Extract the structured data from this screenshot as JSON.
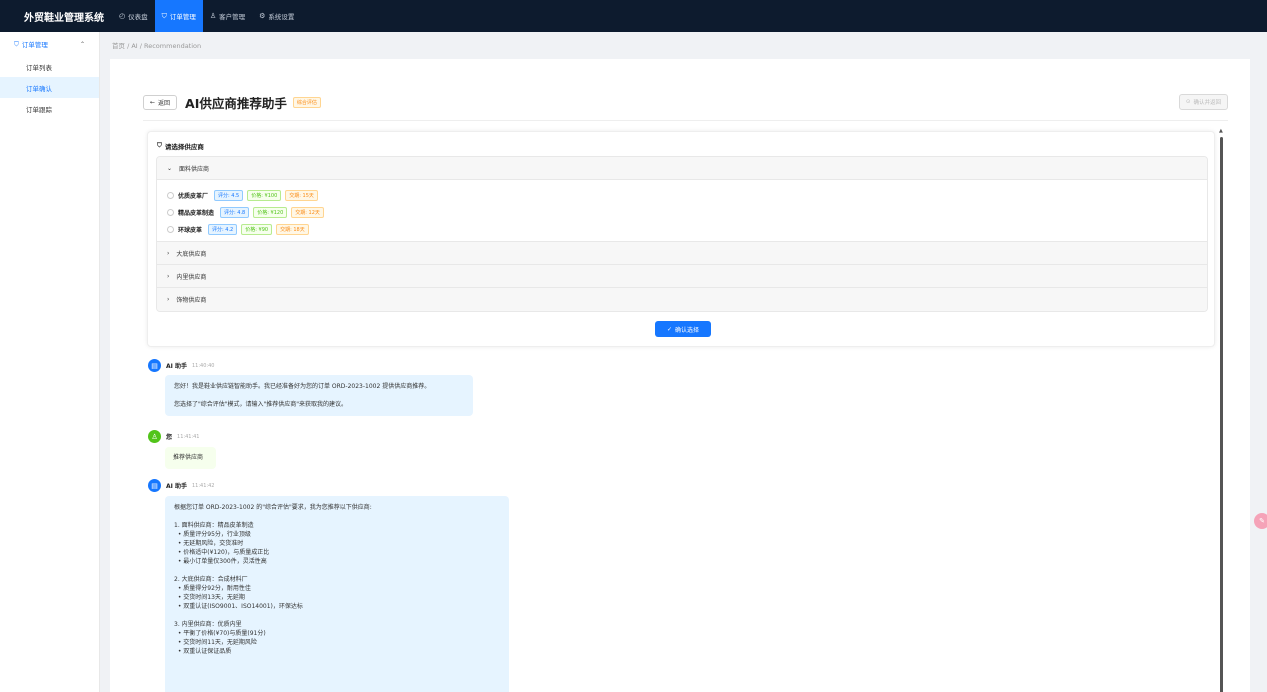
{
  "app": {
    "brand": "外贸鞋业管理系统"
  },
  "topnav": [
    {
      "icon": "dashboard-icon",
      "glyph": "◴",
      "label": "仪表盘",
      "active": false
    },
    {
      "icon": "cart-icon",
      "glyph": "⛉",
      "label": "订单管理",
      "active": true
    },
    {
      "icon": "user-icon",
      "glyph": "♙",
      "label": "客户管理",
      "active": false
    },
    {
      "icon": "gear-icon",
      "glyph": "⚙",
      "label": "系统设置",
      "active": false
    }
  ],
  "sidebar": {
    "group": "订单管理",
    "items": [
      {
        "label": "订单列表",
        "active": false
      },
      {
        "label": "订单确认",
        "active": true
      },
      {
        "label": "订单跟踪",
        "active": false
      }
    ]
  },
  "breadcrumb": "首页 / AI / Recommendation",
  "header": {
    "back_label": "返回",
    "title": "AI供应商推荐助手",
    "mode_tag": "综合评估",
    "confirm_back_label": "确认并返回"
  },
  "selector": {
    "title": "请选择供应商",
    "groups": [
      {
        "label": "面料供应商",
        "expanded": true
      },
      {
        "label": "大底供应商",
        "expanded": false
      },
      {
        "label": "内里供应商",
        "expanded": false
      },
      {
        "label": "饰物供应商",
        "expanded": false
      }
    ],
    "options": [
      {
        "name": "优质皮革厂",
        "score": "评分: 4.5",
        "price": "价格: ¥100",
        "lead": "交期: 15天"
      },
      {
        "name": "精品皮革制造",
        "score": "评分: 4.8",
        "price": "价格: ¥120",
        "lead": "交期: 12天"
      },
      {
        "name": "环球皮革",
        "score": "评分: 4.2",
        "price": "价格: ¥90",
        "lead": "交期: 18天"
      }
    ],
    "confirm_label": "确认选择"
  },
  "chat": [
    {
      "role": "ai",
      "sender": "AI 助手",
      "time": "11:40:40",
      "lines": [
        "您好！我是鞋业供应链智能助手。我已经准备好为您的订单 ORD-2023-1002 提供供应商推荐。",
        "",
        "您选择了\"综合评估\"模式，请输入\"推荐供应商\"来获取我的建议。"
      ]
    },
    {
      "role": "user",
      "sender": "您",
      "time": "11:41:41",
      "lines": [
        "推荐供应商"
      ]
    },
    {
      "role": "ai",
      "sender": "AI 助手",
      "time": "11:41:42",
      "lines": [
        "根据您订单 ORD-2023-1002 的\"综合评估\"要求，我为您推荐以下供应商:",
        "",
        "1. 面料供应商：精品皮革制造",
        "  • 质量评分95分，行业顶级",
        "  • 无延期风险，交货准时",
        "  • 价格适中(¥120)，与质量成正比",
        "  • 最小订单量仅300件，灵活性高",
        "",
        "2. 大底供应商：合成材料厂",
        "  • 质量得分92分，耐用性佳",
        "  • 交货时间13天，无延期",
        "  • 双重认证(ISO9001、ISO14001)，环保达标",
        "",
        "3. 内里供应商：优质内里",
        "  • 平衡了价格(¥70)与质量(91分)",
        "  • 交货时间11天，无延期风险",
        "  • 双重认证保证品质"
      ]
    }
  ]
}
